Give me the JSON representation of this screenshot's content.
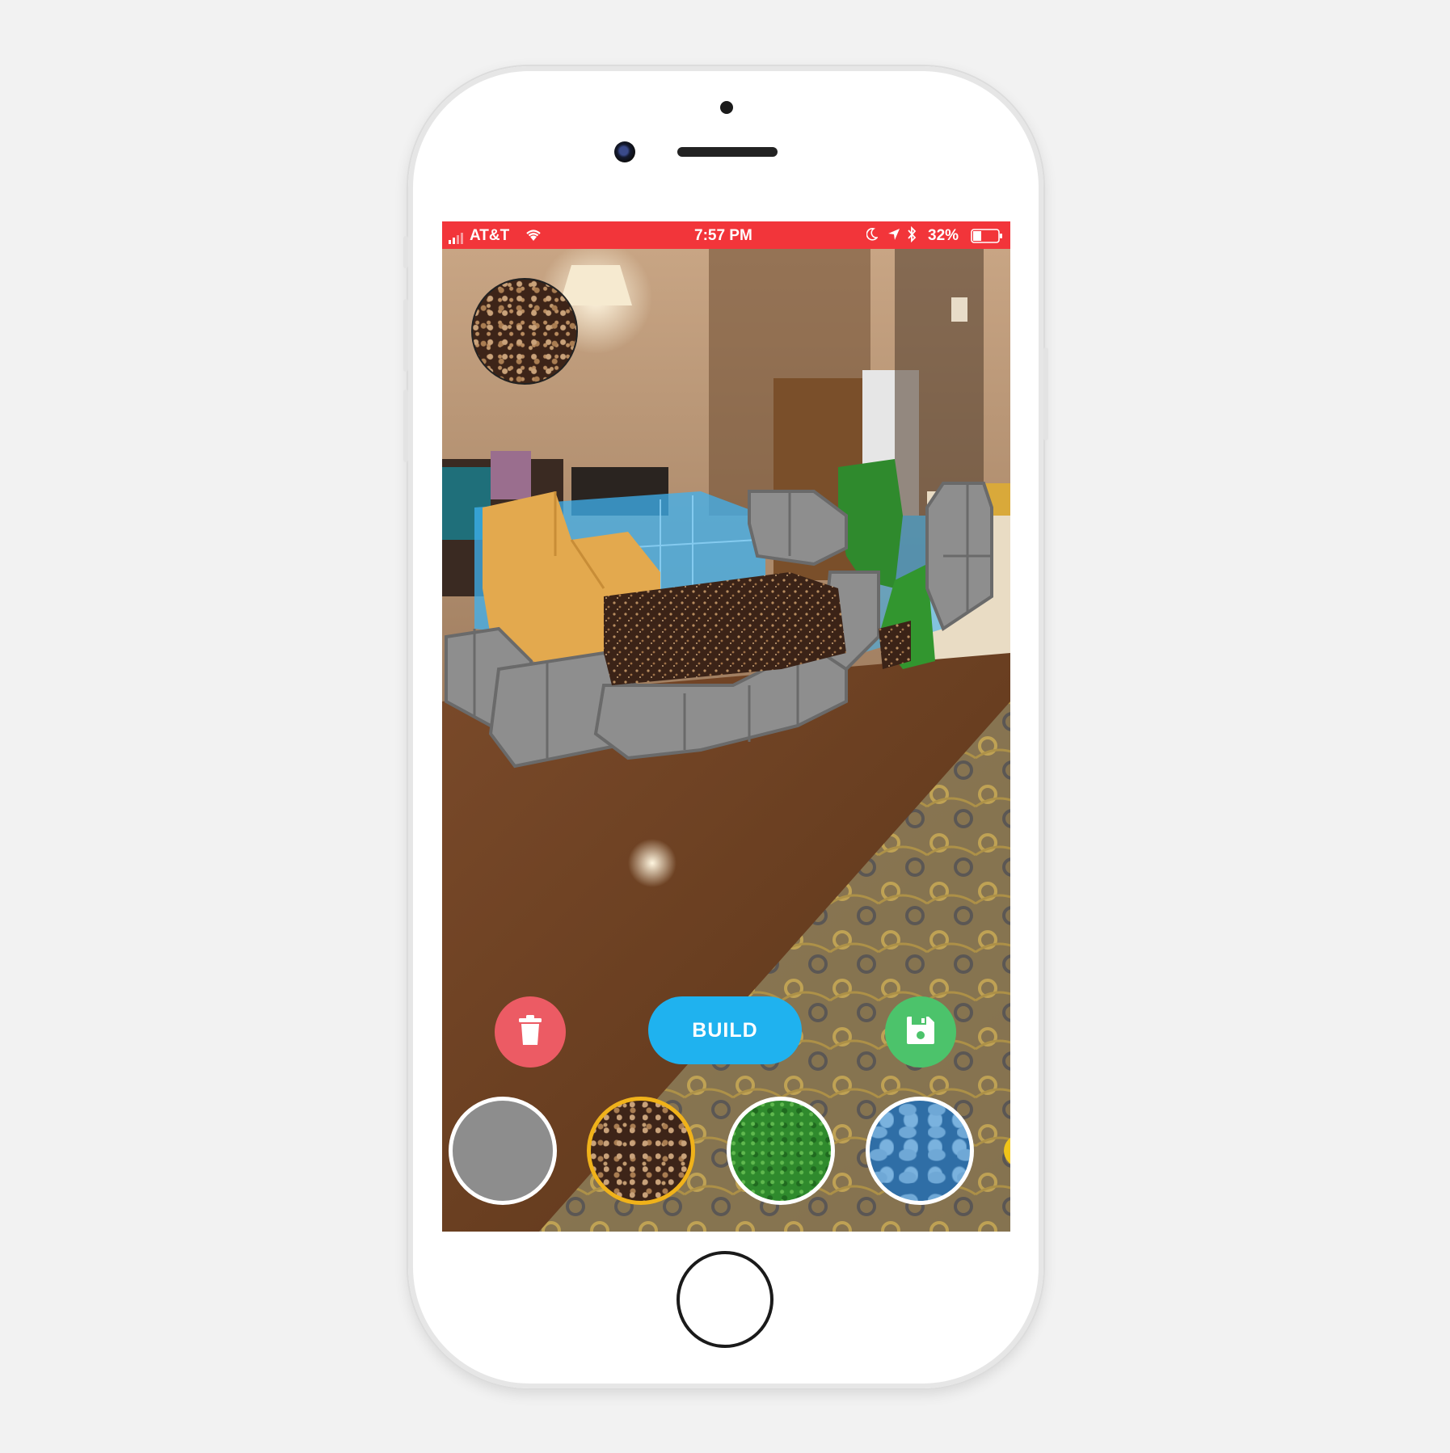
{
  "status_bar": {
    "carrier": "AT&T",
    "time": "7:57 PM",
    "battery": "32%",
    "background_color": "#f2353a"
  },
  "toolbar": {
    "build_label": "BUILD",
    "trash_icon": "trash-icon",
    "save_icon": "floppy-disk-icon"
  },
  "selected_material": "dirt",
  "materials": [
    {
      "name": "stone",
      "color": "#8d8d8d",
      "selected": false
    },
    {
      "name": "dirt",
      "color": "#3d2418",
      "selected": true
    },
    {
      "name": "grass",
      "color": "#2f8a2d",
      "selected": false
    },
    {
      "name": "water",
      "color": "#2f6ea6",
      "selected": false
    },
    {
      "name": "sand",
      "color": "#f0c419",
      "selected": false
    }
  ],
  "colors": {
    "trash_button": "#ec5b64",
    "build_button": "#1fb2ef",
    "save_button": "#4cc36b",
    "selection_ring": "#f0b21a"
  }
}
